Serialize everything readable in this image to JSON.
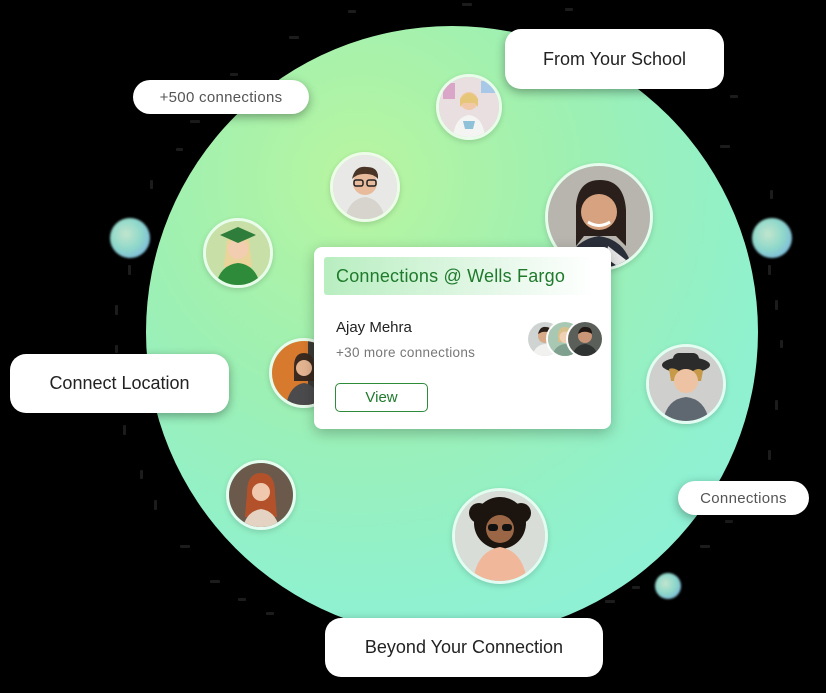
{
  "labels": {
    "from_school": "From Your School",
    "plus_connections": "+500 connections",
    "connect_location": "Connect Location",
    "connections": "Connections",
    "beyond": "Beyond Your Connection"
  },
  "card": {
    "title": "Connections @ Wells Fargo",
    "name": "Ajay Mehra",
    "more": "+30 more connections",
    "view_label": "View"
  },
  "colors": {
    "accent_green": "#1f7a2c",
    "circle_light": "#b8f5a0",
    "circle_mint": "#8ff0e0"
  }
}
